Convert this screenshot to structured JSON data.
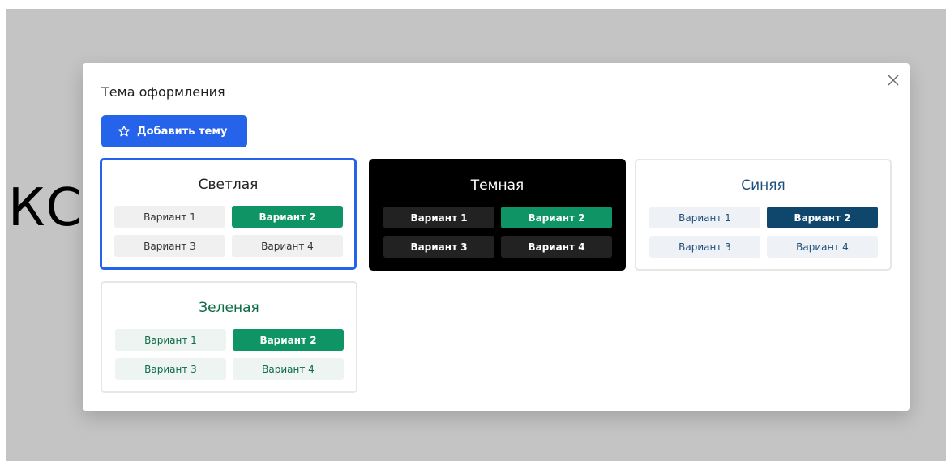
{
  "background": {
    "text": "КС"
  },
  "modal": {
    "title": "Тема оформления",
    "add_button_label": "Добавить тему",
    "accent_color": "#2563eb"
  },
  "themes": [
    {
      "name": "Светлая",
      "selected": true,
      "variants": [
        "Вариант 1",
        "Вариант 2",
        "Вариант 3",
        "Вариант 4"
      ],
      "active_variant": "Вариант 2",
      "active_color": "#0e9465"
    },
    {
      "name": "Темная",
      "selected": false,
      "variants": [
        "Вариант 1",
        "Вариант 2",
        "Вариант 3",
        "Вариант 4"
      ],
      "active_variant": "Вариант 2",
      "background_color": "#000000",
      "active_color": "#0e9465"
    },
    {
      "name": "Синяя",
      "selected": false,
      "variants": [
        "Вариант 1",
        "Вариант 2",
        "Вариант 3",
        "Вариант 4"
      ],
      "active_variant": "Вариант 2",
      "active_color": "#0f466b"
    },
    {
      "name": "Зеленая",
      "selected": false,
      "variants": [
        "Вариант 1",
        "Вариант 2",
        "Вариант 3",
        "Вариант 4"
      ],
      "active_variant": "Вариант 2",
      "active_color": "#0e9465"
    }
  ],
  "icons": {
    "close": "close-icon",
    "add": "star-icon"
  }
}
